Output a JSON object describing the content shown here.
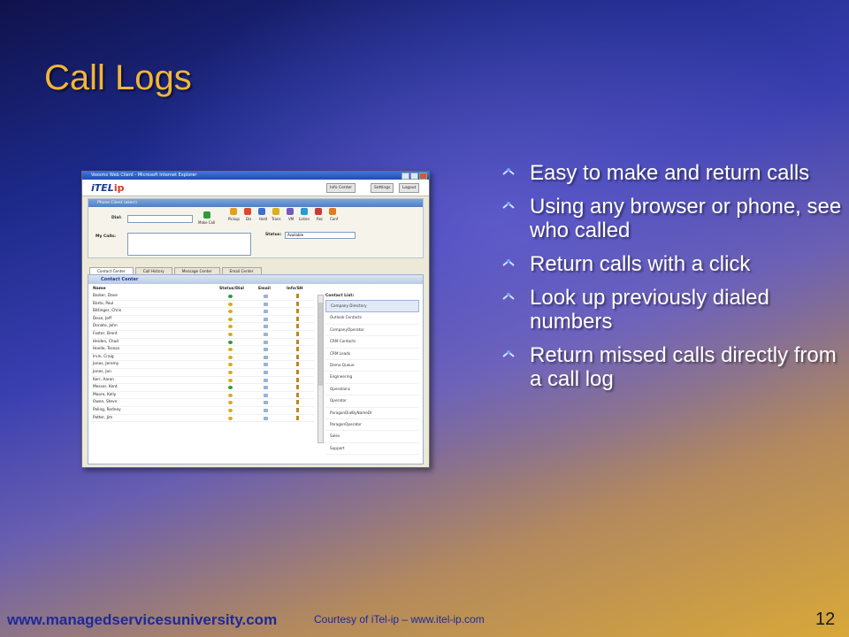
{
  "slide": {
    "title": "Call Logs",
    "bullets": [
      "Easy to make and return calls",
      "Using any browser or phone, see who called",
      "Return calls with a click",
      "Look up previously dialed numbers",
      "Return missed calls directly from a call log"
    ],
    "footer_url": "www.managedservicesuniversity.com",
    "courtesy": "Courtesy of iTel-ip – www.itel-ip.com",
    "page_number": "12"
  },
  "screenshot": {
    "window_title": "Voxsmx Web Client - Microsoft Internet Explorer",
    "logo_main": "iTEL",
    "logo_sub": "ip",
    "header_buttons": [
      "Info Center",
      "Settings",
      "Logout"
    ],
    "panel_title": "Phone Client (akerr)",
    "dial_label": "Dial:",
    "my_calls_label": "My Calls:",
    "status_label": "Status:",
    "status_value": "Available",
    "tools": [
      "Make Call",
      "Pickup",
      "Dis",
      "Hold",
      "Trans",
      "VM",
      "Listen",
      "Rec",
      "Conf"
    ],
    "tabs": [
      "Contact Center",
      "Call History",
      "Message Center",
      "Email Center"
    ],
    "contact_center_title": "Contact Center",
    "columns": [
      "Name",
      "Status/Dial",
      "Email",
      "Info/SH"
    ],
    "contacts": [
      "Barker, Dave",
      "Barto, Paul",
      "Bittinger, Chris",
      "Dean, Jeff",
      "Donato, John",
      "Foster, Brent",
      "Heiden, Chad",
      "Hoelle, Teresa",
      "Irvin, Craig",
      "Jones, Jeremy",
      "Jones, Jon",
      "Kerr, Aaron",
      "Messer, Kent",
      "Moore, Kelly",
      "Owen, Steve",
      "Poling, Rodney",
      "Potter, Jim"
    ],
    "contact_list_label": "Contact List:",
    "contact_lists": [
      "Company Directory",
      "Outlook Contacts",
      "CompanyOperator",
      "CRM Contacts",
      "CRM Leads",
      "Demo Queue",
      "Engineering",
      "Operations",
      "Operator",
      "ParagonDialByNameDr",
      "ParagonOperator",
      "Sales",
      "Support"
    ]
  }
}
